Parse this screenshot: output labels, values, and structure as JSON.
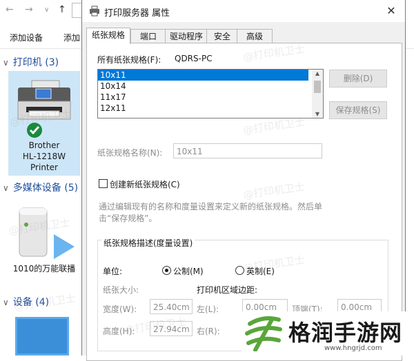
{
  "explorer": {
    "toolbar": [
      "添加设备",
      "添加"
    ],
    "sections": [
      {
        "name": "打印机",
        "count": "(3)"
      },
      {
        "name": "多媒体设备",
        "count": "(5)"
      },
      {
        "name": "设备",
        "count": "(4)"
      }
    ],
    "printer": {
      "line1": "Brother",
      "line2": "HL-1218W",
      "line3": "Printer"
    },
    "media_device": {
      "label": "1010的万能联播"
    }
  },
  "dialog": {
    "title": "打印服务器 属性",
    "close": "✕",
    "tabs": [
      "纸张规格",
      "端口",
      "驱动程序",
      "安全",
      "高级"
    ],
    "active_tab": "纸张规格",
    "all_forms_label": "所有纸张规格(F):",
    "server_name": "QDRS-PC",
    "forms": [
      "10x11",
      "10x14",
      "11x17",
      "12x11"
    ],
    "selected_form": "10x11",
    "delete_button": "删除(D)",
    "save_button": "保存规格(S)",
    "form_name_label": "纸张规格名称(N):",
    "form_name_value": "10x11",
    "create_new_label": "创建新纸张规格(C)",
    "hint_line1": "通过编辑现有的名称和度量设置来定义新的纸张规格。然后单",
    "hint_line2": "击“保存规格”。",
    "group_title": "纸张规格描述(度量设置)",
    "unit_label": "单位:",
    "unit_metric": "公制(M)",
    "unit_english": "英制(E)",
    "paper_size_label": "纸张大小:",
    "margins_label": "打印机区域边距:",
    "width_label": "宽度(W):",
    "width_value": "25.40cm",
    "height_label": "高度(H):",
    "height_value": "27.94cm",
    "left_label": "左(L):",
    "left_value": "0.00cm",
    "right_label": "右(R):",
    "top_label": "顶端(T):",
    "top_value": "0.00cm"
  },
  "watermark": "@打印机卫士",
  "brand": {
    "name": "格润手游网",
    "url": "www.hngrjd.com",
    "accent": "#5aa63a"
  }
}
